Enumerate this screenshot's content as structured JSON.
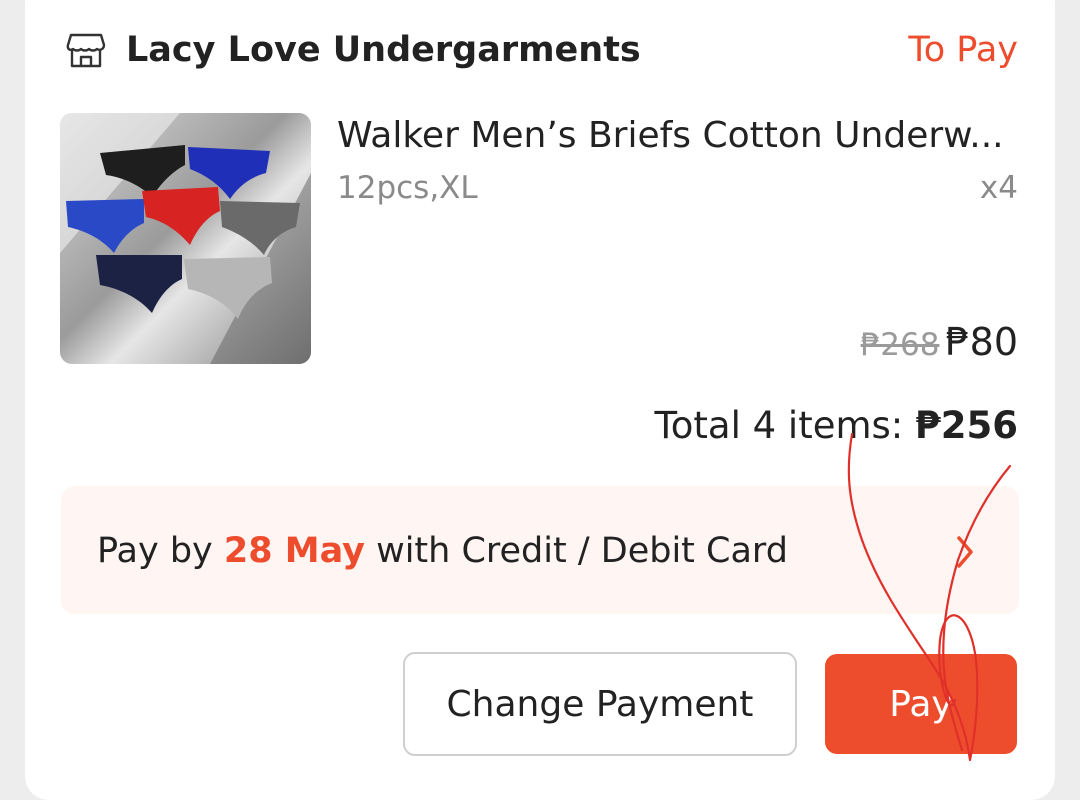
{
  "shop": {
    "name": "Lacy Love Undergarments",
    "status": "To Pay",
    "icon": "store-icon"
  },
  "product": {
    "title": "Walker Men’s Briefs Cotton Underw...",
    "variation": "12pcs,XL",
    "quantity": "x4",
    "original_price": "₱268",
    "price": "₱80",
    "image_icon": "product-image"
  },
  "order_total": {
    "label": "Total 4 items: ",
    "amount": "₱256"
  },
  "payment_banner": {
    "prefix": "Pay by ",
    "due_date": "28 May",
    "suffix": " with Credit / Debit Card",
    "icon": "chevron-right-icon"
  },
  "actions": {
    "change_payment_label": "Change Payment",
    "pay_label": "Pay"
  },
  "colors": {
    "accent": "#ee4d2d",
    "banner_bg": "#fff6f4",
    "text": "#222222",
    "muted": "#8a8a8a",
    "annotation": "#e0302a"
  }
}
